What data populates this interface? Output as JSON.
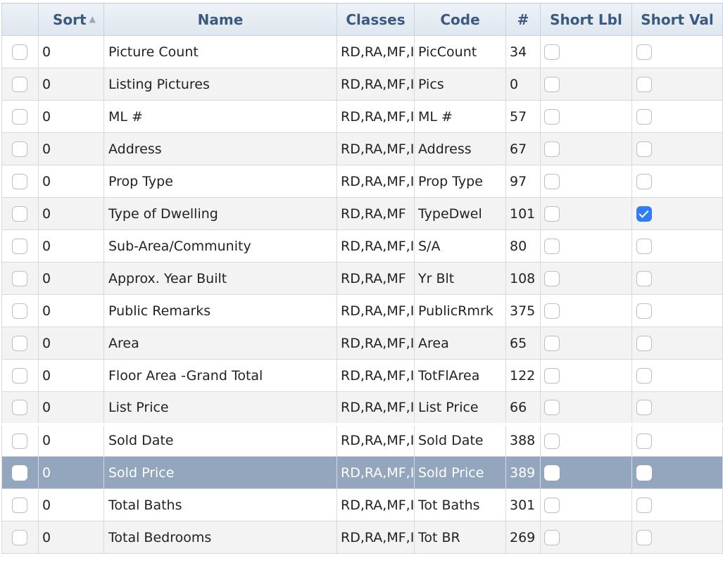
{
  "headers": {
    "sort": "Sort",
    "name": "Name",
    "classes": "Classes",
    "code": "Code",
    "count": "#",
    "short_lbl": "Short Lbl",
    "short_val": "Short Val"
  },
  "sort_indicator_icon": "sort-arrows-icon",
  "selection_color": "#93a6bd",
  "check_color": "#2f7df6",
  "rows": [
    {
      "sort": "0",
      "name": "Picture Count",
      "classes": "RD,RA,MF,I",
      "code": "PicCount",
      "count": "34",
      "selected": false,
      "short_lbl": false,
      "short_val": false
    },
    {
      "sort": "0",
      "name": "Listing Pictures",
      "classes": "RD,RA,MF,I",
      "code": "Pics",
      "count": "0",
      "selected": false,
      "short_lbl": false,
      "short_val": false
    },
    {
      "sort": "0",
      "name": "ML #",
      "classes": "RD,RA,MF,I",
      "code": "ML #",
      "count": "57",
      "selected": false,
      "short_lbl": false,
      "short_val": false
    },
    {
      "sort": "0",
      "name": "Address",
      "classes": "RD,RA,MF,I",
      "code": "Address",
      "count": "67",
      "selected": false,
      "short_lbl": false,
      "short_val": false
    },
    {
      "sort": "0",
      "name": "Prop Type",
      "classes": "RD,RA,MF,I",
      "code": "Prop Type",
      "count": "97",
      "selected": false,
      "short_lbl": false,
      "short_val": false
    },
    {
      "sort": "0",
      "name": "Type of Dwelling",
      "classes": "RD,RA,MF",
      "code": "TypeDwel",
      "count": "101",
      "selected": false,
      "short_lbl": false,
      "short_val": true
    },
    {
      "sort": "0",
      "name": "Sub-Area/Community",
      "classes": "RD,RA,MF,I",
      "code": "S/A",
      "count": "80",
      "selected": false,
      "short_lbl": false,
      "short_val": false
    },
    {
      "sort": "0",
      "name": "Approx. Year Built",
      "classes": "RD,RA,MF",
      "code": "Yr Blt",
      "count": "108",
      "selected": false,
      "short_lbl": false,
      "short_val": false
    },
    {
      "sort": "0",
      "name": "Public Remarks",
      "classes": "RD,RA,MF,I",
      "code": "PublicRmrk",
      "count": "375",
      "selected": false,
      "short_lbl": false,
      "short_val": false
    },
    {
      "sort": "0",
      "name": "Area",
      "classes": "RD,RA,MF,I",
      "code": "Area",
      "count": "65",
      "selected": false,
      "short_lbl": false,
      "short_val": false
    },
    {
      "sort": "0",
      "name": "Floor Area -Grand Total",
      "classes": "RD,RA,MF,I",
      "code": "TotFlArea",
      "count": "122",
      "selected": false,
      "short_lbl": false,
      "short_val": false
    },
    {
      "sort": "0",
      "name": "List Price",
      "classes": "RD,RA,MF,I",
      "code": "List Price",
      "count": "66",
      "selected": false,
      "short_lbl": false,
      "short_val": false
    },
    {
      "sort": "0",
      "name": "Sold Date",
      "classes": "RD,RA,MF,I",
      "code": "Sold Date",
      "count": "388",
      "selected": false,
      "short_lbl": false,
      "short_val": false
    },
    {
      "sort": "0",
      "name": "Sold Price",
      "classes": "RD,RA,MF,I",
      "code": "Sold Price",
      "count": "389",
      "selected": true,
      "short_lbl": false,
      "short_val": false
    },
    {
      "sort": "0",
      "name": "Total Baths",
      "classes": "RD,RA,MF,I",
      "code": "Tot Baths",
      "count": "301",
      "selected": false,
      "short_lbl": false,
      "short_val": false
    },
    {
      "sort": "0",
      "name": "Total Bedrooms",
      "classes": "RD,RA,MF,I",
      "code": "Tot BR",
      "count": "269",
      "selected": false,
      "short_lbl": false,
      "short_val": false
    }
  ]
}
